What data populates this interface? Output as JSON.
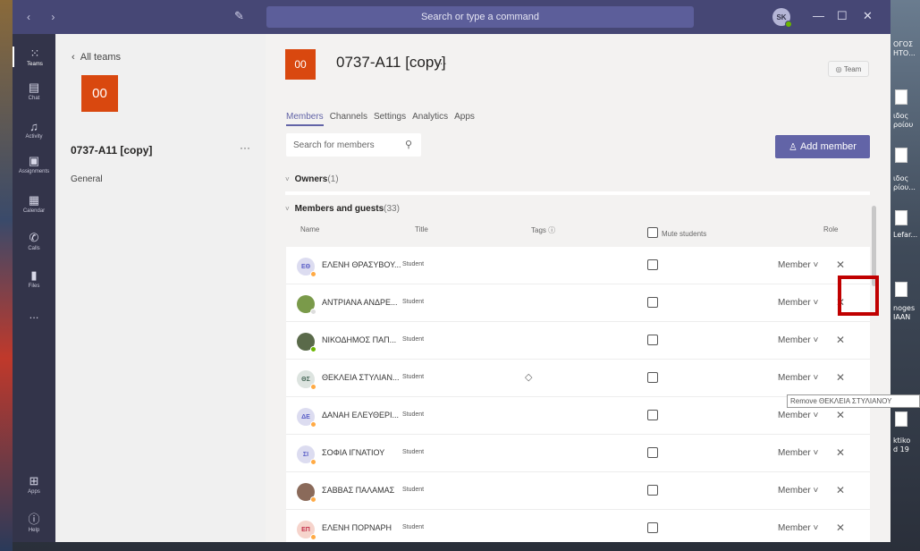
{
  "titlebar": {
    "search_placeholder": "Search or type a command",
    "avatar_initials": "SK"
  },
  "rail": [
    {
      "label": "Teams",
      "icon": "teams-icon"
    },
    {
      "label": "Chat",
      "icon": "chat-icon"
    },
    {
      "label": "Activity",
      "icon": "bell-icon"
    },
    {
      "label": "Assignments",
      "icon": "assignments-icon"
    },
    {
      "label": "Calendar",
      "icon": "calendar-icon"
    },
    {
      "label": "Calls",
      "icon": "phone-icon"
    },
    {
      "label": "Files",
      "icon": "file-icon"
    },
    {
      "label": "...",
      "icon": "more-icon"
    },
    {
      "label": "Apps",
      "icon": "apps-icon"
    },
    {
      "label": "Help",
      "icon": "help-icon"
    }
  ],
  "team_panel": {
    "back_label": "All teams",
    "tile_label": "00",
    "team_name": "0737-A11 [copy]",
    "more": "···",
    "channel": "General"
  },
  "header": {
    "tile_label": "00",
    "title": "0737-A11 [copy]",
    "more": "···",
    "team_badge": "Team"
  },
  "tabs": [
    "Members",
    "Channels",
    "Settings",
    "Analytics",
    "Apps"
  ],
  "member_search_placeholder": "Search for members",
  "add_member_label": "Add member",
  "owners": {
    "label": "Owners",
    "count": "(1)"
  },
  "members": {
    "label": "Members and guests",
    "count": "(33)"
  },
  "columns": {
    "name": "Name",
    "title": "Title",
    "tags": "Tags",
    "mute": "Mute students",
    "role": "Role"
  },
  "rows": [
    {
      "initials": "ΕΘ",
      "name": "ΕΛΕΝΗ ΘΡΑΣΥΒΟΥ...",
      "title": "Student",
      "role": "Member",
      "tag": ""
    },
    {
      "initials": "",
      "name": "ΑΝΤΡΙΑΝΑ ΑΝΔΡΕ...",
      "title": "Student",
      "role": "Member",
      "tag": ""
    },
    {
      "initials": "",
      "name": "ΝΙΚΟΔΗΜΟΣ ΠΑΠ...",
      "title": "Student",
      "role": "Member",
      "tag": ""
    },
    {
      "initials": "ΘΣ",
      "name": "ΘΕΚΛΕΙΑ ΣΤΥΛΙΑΝ...",
      "title": "Student",
      "role": "Member",
      "tag": "tag-icon"
    },
    {
      "initials": "ΔΕ",
      "name": "ΔΑΝΑΗ ΕΛΕΥΘΕΡΙ...",
      "title": "Student",
      "role": "Member",
      "tag": ""
    },
    {
      "initials": "ΣΙ",
      "name": "ΣΟΦΙΑ ΙΓΝΑΤΙΟΥ",
      "title": "Student",
      "role": "Member",
      "tag": ""
    },
    {
      "initials": "",
      "name": "ΣΑΒΒΑΣ ΠΑΛΑΜΑΣ",
      "title": "Student",
      "role": "Member",
      "tag": ""
    },
    {
      "initials": "ΕΠ",
      "name": "ΕΛΕΝΗ ΠΟΡΝΑΡΗ",
      "title": "Student",
      "role": "Member",
      "tag": ""
    }
  ],
  "tooltip": "Remove ΘΕΚΛΕΙΑ ΣΤΥΛΙΑΝΟΥ",
  "desktop_right": [
    "ΟΓΟΣ",
    "ΗΤΟ...",
    "ιδος",
    "ροίου",
    "ιδος",
    "ρίου...",
    "Lefar...",
    "noges",
    "ΙΑΑΝ",
    "ktiko",
    "d 19"
  ],
  "colors": {
    "accent": "#6264a7",
    "titlebar": "#464775",
    "rail": "#33344a",
    "tile": "#d9480f",
    "highlight": "#c00000"
  }
}
